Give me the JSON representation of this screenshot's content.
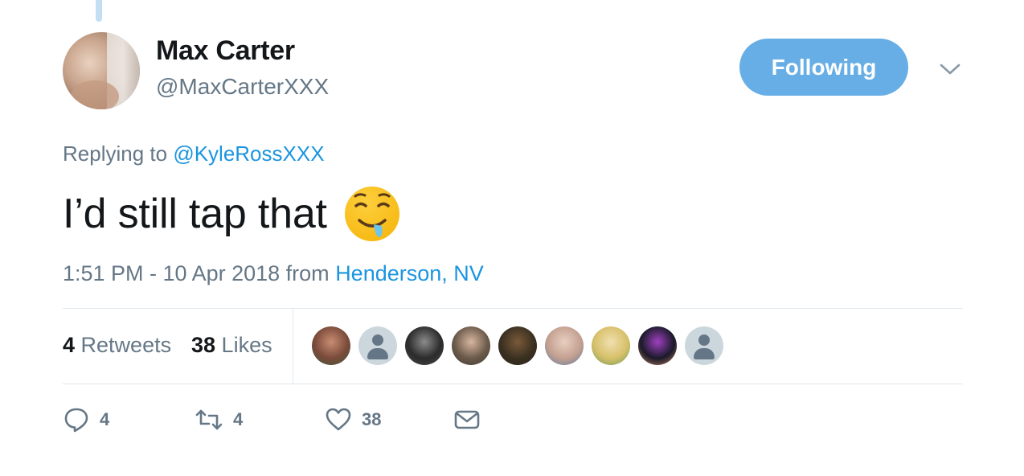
{
  "tweet": {
    "author_name": "Max Carter",
    "author_handle": "@MaxCarterXXX",
    "follow_button_label": "Following",
    "reply_prefix": "Replying to ",
    "reply_mention": "@KyleRossXXX",
    "text": "I’d still tap that",
    "emoji": "drooling-face-emoji",
    "timestamp": "1:51 PM - 10 Apr 2018 from ",
    "location": "Henderson, NV"
  },
  "stats": {
    "retweets_count": "4",
    "retweets_label": " Retweets",
    "likes_count": "38",
    "likes_label": " Likes"
  },
  "likers": [
    {
      "type": "photo",
      "colors": [
        "#7a4a3a",
        "#c98d72",
        "#3d5a3a"
      ]
    },
    {
      "type": "default"
    },
    {
      "type": "photo",
      "colors": [
        "#2b2b2b",
        "#8b8b8b",
        "#4a4a4a"
      ]
    },
    {
      "type": "photo",
      "colors": [
        "#6b5a4a",
        "#d8b6a0",
        "#3e3a34"
      ]
    },
    {
      "type": "photo",
      "colors": [
        "#3a3020",
        "#7b5a3a",
        "#2a2418"
      ]
    },
    {
      "type": "photo",
      "colors": [
        "#c4a090",
        "#e8cfc2",
        "#5a7aa0"
      ]
    },
    {
      "type": "photo",
      "colors": [
        "#d7c06a",
        "#f0e0b0",
        "#6a9a5a"
      ]
    },
    {
      "type": "photo",
      "colors": [
        "#1a1a2a",
        "#a040c0",
        "#c08060"
      ]
    },
    {
      "type": "default"
    }
  ],
  "actions": {
    "reply_count": "4",
    "retweet_count": "4",
    "like_count": "38"
  },
  "colors": {
    "accent": "#1b95e0",
    "follow_button": "#66aee5",
    "muted": "#657786",
    "text": "#14171a"
  }
}
